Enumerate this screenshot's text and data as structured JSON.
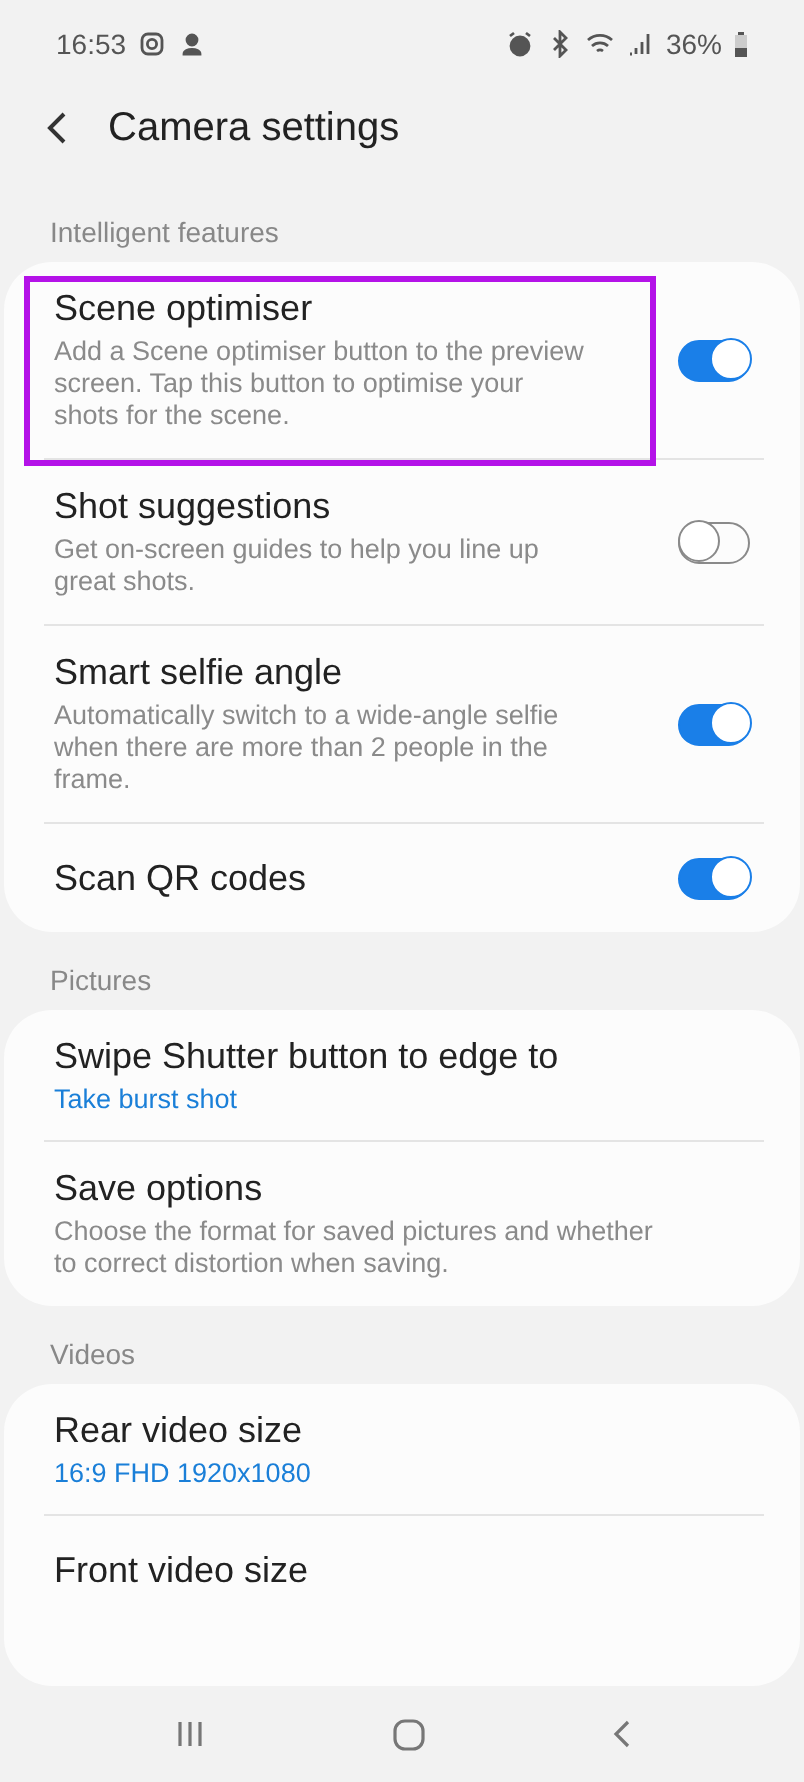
{
  "status_bar": {
    "time": "16:53",
    "battery": "36%"
  },
  "header": {
    "title": "Camera settings"
  },
  "sections": [
    {
      "title": "Intelligent features",
      "items": [
        {
          "kind": "toggle",
          "title": "Scene optimiser",
          "description": "Add a Scene optimiser button to the preview screen. Tap this button to optimise your shots for the scene.",
          "on": true,
          "highlighted": true
        },
        {
          "kind": "toggle",
          "title": "Shot suggestions",
          "description": "Get on-screen guides to help you line up great shots.",
          "on": false,
          "highlighted": false
        },
        {
          "kind": "toggle",
          "title": "Smart selfie angle",
          "description": "Automatically switch to a wide-angle selfie when there are more than 2 people in the frame.",
          "on": true,
          "highlighted": false
        },
        {
          "kind": "toggle",
          "title": "Scan QR codes",
          "on": true,
          "highlighted": false
        }
      ]
    },
    {
      "title": "Pictures",
      "items": [
        {
          "kind": "value",
          "title": "Swipe Shutter button to edge to",
          "value": "Take burst shot"
        },
        {
          "kind": "info",
          "title": "Save options",
          "description": "Choose the format for saved pictures and whether to correct distortion when saving."
        }
      ]
    },
    {
      "title": "Videos",
      "items": [
        {
          "kind": "value",
          "title": "Rear video size",
          "value": "16:9 FHD 1920x1080"
        },
        {
          "kind": "info",
          "title": "Front video size"
        }
      ]
    }
  ]
}
